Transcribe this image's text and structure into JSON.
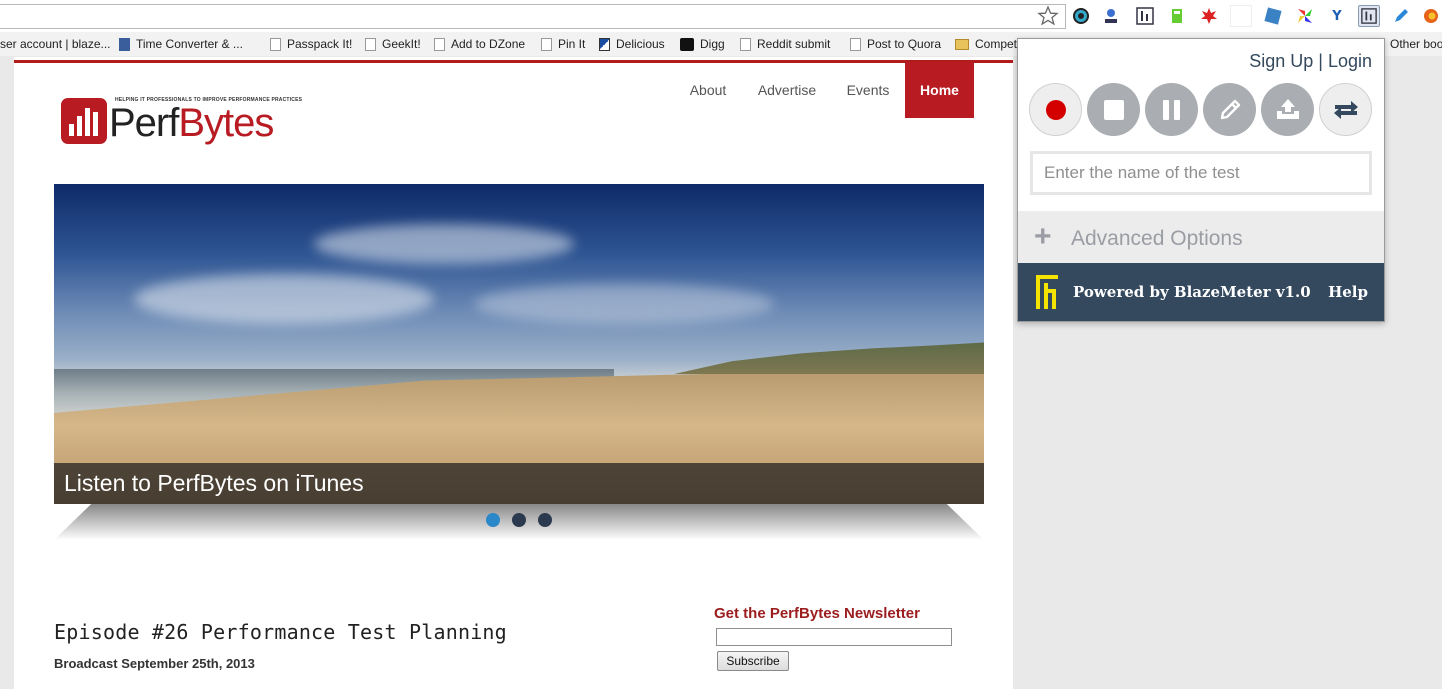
{
  "browser": {
    "bookmarks": [
      {
        "label": "ser account | blaze..."
      },
      {
        "label": "Time Converter & ..."
      },
      {
        "label": "Passpack It!"
      },
      {
        "label": "GeekIt!"
      },
      {
        "label": "Add to DZone"
      },
      {
        "label": "Pin It"
      },
      {
        "label": "Delicious"
      },
      {
        "label": "Digg"
      },
      {
        "label": "Reddit submit"
      },
      {
        "label": "Post to Quora"
      },
      {
        "label": "Compet"
      },
      {
        "label": "Other book"
      }
    ],
    "extension_icons": [
      "chrome-color-icon",
      "download-icon",
      "blazemeter-icon",
      "evernote-icon",
      "star-burst-icon",
      "blank-icon",
      "puzzle-icon",
      "pinwheel-icon",
      "v-icon",
      "blazemeter-icon",
      "pen-icon",
      "firefox-icon"
    ]
  },
  "site": {
    "logo_tagline": "HELPING IT PROFESSIONALS TO IMPROVE PERFORMANCE PRACTICES",
    "logo_perf": "Perf",
    "logo_bytes": "Bytes",
    "nav": {
      "about": "About",
      "advertise": "Advertise",
      "events": "Events",
      "home": "Home"
    },
    "slider": {
      "caption": "Listen to PerfBytes on iTunes",
      "slide_count": 3,
      "active_slide": 1
    },
    "episode": {
      "title": "Episode #26 Performance Test Planning",
      "date": "Broadcast September 25th, 2013"
    },
    "newsletter": {
      "title": "Get the PerfBytes Newsletter",
      "button": "Subscribe"
    }
  },
  "popup": {
    "sign_up": "Sign Up",
    "separator": "|",
    "login": "Login",
    "test_name_placeholder": "Enter the name of the test",
    "advanced_options": "Advanced Options",
    "powered_by": "Powered by BlazeMeter v1.0",
    "help": "Help",
    "colors": {
      "record": "#d40000",
      "footer": "#34495e",
      "logo": "#f5e400"
    }
  }
}
